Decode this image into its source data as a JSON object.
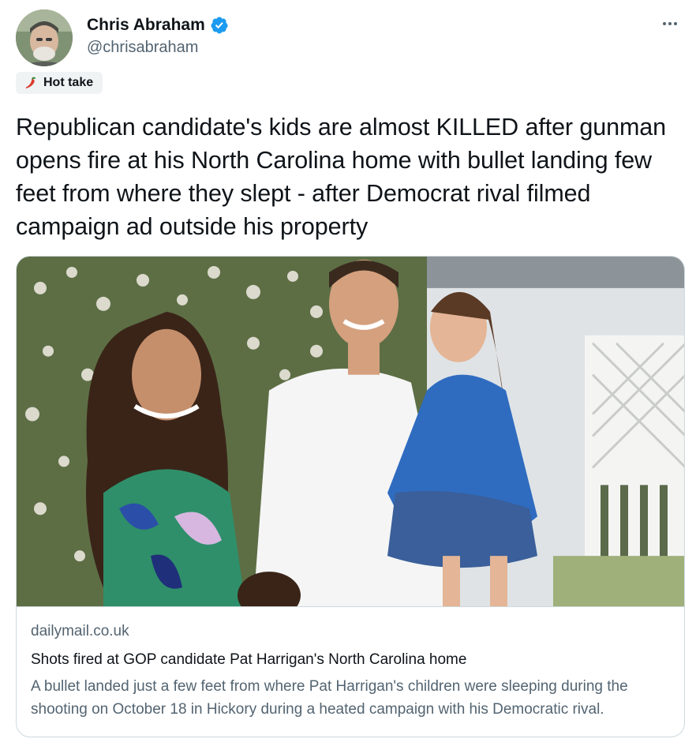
{
  "author": {
    "display_name": "Chris Abraham",
    "handle": "@chrisabraham",
    "verified": true,
    "avatar_icon": "profile-photo"
  },
  "menu": {
    "icon": "more-dots-icon"
  },
  "label_chip": {
    "icon": "chili-pepper-icon",
    "text": "Hot take"
  },
  "tweet": {
    "text": "Republican candidate's kids are almost KILLED after gunman opens fire at his North Carolina home with bullet landing few feet from where they slept - after Democrat rival filmed campaign ad outside his property"
  },
  "link_card": {
    "image": "family-photo",
    "domain": "dailymail.co.uk",
    "title": "Shots fired at GOP candidate Pat Harrigan's North Carolina home",
    "description": "A bullet landed just a few feet from where Pat Harrigan's children were sleeping during the shooting on October 18 in Hickory during a heated campaign with his Democratic rival."
  },
  "colors": {
    "verified_blue": "#1d9bf0",
    "secondary_text": "#536471",
    "border": "#cfd9de",
    "chip_bg": "#eff3f4"
  }
}
